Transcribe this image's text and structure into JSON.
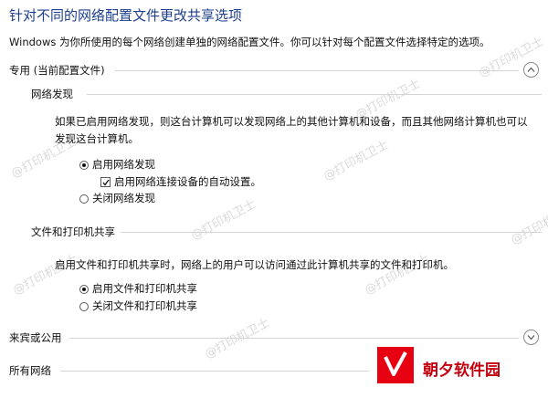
{
  "header": {
    "title": "针对不同的网络配置文件更改共享选项",
    "subtitle": "Windows 为你所使用的每个网络创建单独的网络配置文件。你可以针对每个配置文件选择特定的选项。"
  },
  "private": {
    "label": "专用 (当前配置文件)",
    "network_discovery": {
      "label": "网络发现",
      "description": "如果已启用网络发现，则这台计算机可以发现网络上的其他计算机和设备，而且其他网络计算机也可以发现这台计算机。",
      "enable_label": "启用网络发现",
      "auto_setup_label": "启用网络连接设备的自动设置。",
      "disable_label": "关闭网络发现"
    },
    "file_printer_sharing": {
      "label": "文件和打印机共享",
      "description": "启用文件和打印机共享时，网络上的用户可以访问通过此计算机共享的文件和打印机。",
      "enable_label": "启用文件和打印机共享",
      "disable_label": "关闭文件和打印机共享"
    }
  },
  "guest_public": {
    "label": "来宾或公用"
  },
  "all_networks": {
    "label": "所有网络"
  },
  "watermark": {
    "text": "@打印机卫士"
  },
  "brand": {
    "name": "朝夕软件园",
    "color": "#e60012"
  },
  "icons": {
    "expanded": "chevron-up-icon",
    "collapsed": "chevron-down-icon",
    "checkmark": "check-icon",
    "logo": "chaoxi-logo-icon"
  }
}
